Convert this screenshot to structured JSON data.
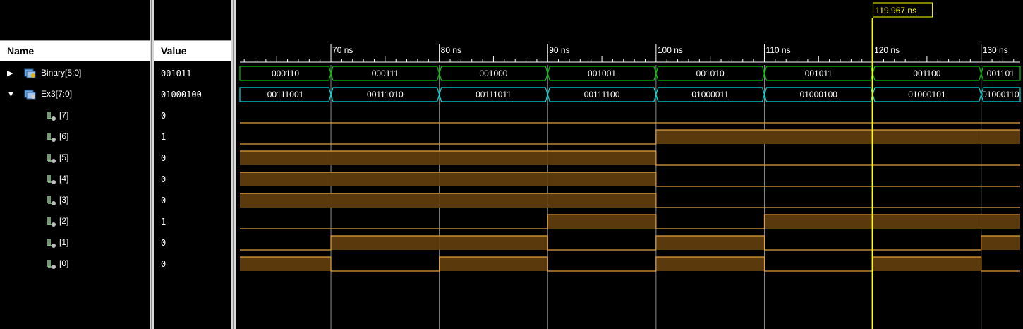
{
  "columns": {
    "name": "Name",
    "value": "Value"
  },
  "cursor": {
    "label": "119.967 ns",
    "time_ns": 119.967,
    "color": "#ffff00"
  },
  "timeline": {
    "start_ns": 61.6,
    "end_ns": 133.6,
    "major_ticks": [
      {
        "t": 70,
        "label": "70 ns"
      },
      {
        "t": 80,
        "label": "80 ns"
      },
      {
        "t": 90,
        "label": "90 ns"
      },
      {
        "t": 100,
        "label": "100 ns"
      },
      {
        "t": 110,
        "label": "110 ns"
      },
      {
        "t": 120,
        "label": "120 ns"
      },
      {
        "t": 130,
        "label": "130 ns"
      }
    ],
    "minor_step_ns": 1
  },
  "colors": {
    "binary_bus": "#00c800",
    "ex3_bus": "#00e0e0",
    "bit_line": "#e0a040",
    "bit_fill": "#5a3a0c",
    "grid": "#8a8a8a"
  },
  "signals": [
    {
      "name": "Binary[5:0]",
      "value": "001011",
      "kind": "bus",
      "expand": "▶",
      "segments": [
        {
          "t0": 61.6,
          "t1": 70,
          "v": "000110"
        },
        {
          "t0": 70,
          "t1": 80,
          "v": "000111"
        },
        {
          "t0": 80,
          "t1": 90,
          "v": "001000"
        },
        {
          "t0": 90,
          "t1": 100,
          "v": "001001"
        },
        {
          "t0": 100,
          "t1": 110,
          "v": "001010"
        },
        {
          "t0": 110,
          "t1": 120,
          "v": "001011"
        },
        {
          "t0": 120,
          "t1": 130,
          "v": "001100"
        },
        {
          "t0": 130,
          "t1": 133.6,
          "v": "001101"
        }
      ]
    },
    {
      "name": "Ex3[7:0]",
      "value": "01000100",
      "kind": "bus",
      "expand": "▼",
      "segments": [
        {
          "t0": 61.6,
          "t1": 70,
          "v": "00111001"
        },
        {
          "t0": 70,
          "t1": 80,
          "v": "00111010"
        },
        {
          "t0": 80,
          "t1": 90,
          "v": "00111011"
        },
        {
          "t0": 90,
          "t1": 100,
          "v": "00111100"
        },
        {
          "t0": 100,
          "t1": 110,
          "v": "01000011"
        },
        {
          "t0": 110,
          "t1": 120,
          "v": "01000100"
        },
        {
          "t0": 120,
          "t1": 130,
          "v": "01000101"
        },
        {
          "t0": 130,
          "t1": 133.6,
          "v": "01000110"
        }
      ]
    },
    {
      "name": "[7]",
      "value": "0",
      "kind": "bit",
      "bits": [
        0,
        0,
        0,
        0,
        0,
        0,
        0,
        0
      ]
    },
    {
      "name": "[6]",
      "value": "1",
      "kind": "bit",
      "bits": [
        0,
        0,
        0,
        0,
        1,
        1,
        1,
        1
      ]
    },
    {
      "name": "[5]",
      "value": "0",
      "kind": "bit",
      "bits": [
        1,
        1,
        1,
        1,
        0,
        0,
        0,
        0
      ]
    },
    {
      "name": "[4]",
      "value": "0",
      "kind": "bit",
      "bits": [
        1,
        1,
        1,
        1,
        0,
        0,
        0,
        0
      ]
    },
    {
      "name": "[3]",
      "value": "0",
      "kind": "bit",
      "bits": [
        1,
        1,
        1,
        1,
        0,
        0,
        0,
        0
      ]
    },
    {
      "name": "[2]",
      "value": "1",
      "kind": "bit",
      "bits": [
        0,
        0,
        0,
        1,
        0,
        1,
        1,
        1
      ]
    },
    {
      "name": "[1]",
      "value": "0",
      "kind": "bit",
      "bits": [
        0,
        1,
        1,
        0,
        1,
        0,
        0,
        1
      ]
    },
    {
      "name": "[0]",
      "value": "0",
      "kind": "bit",
      "bits": [
        1,
        0,
        1,
        0,
        1,
        0,
        1,
        0
      ]
    }
  ]
}
